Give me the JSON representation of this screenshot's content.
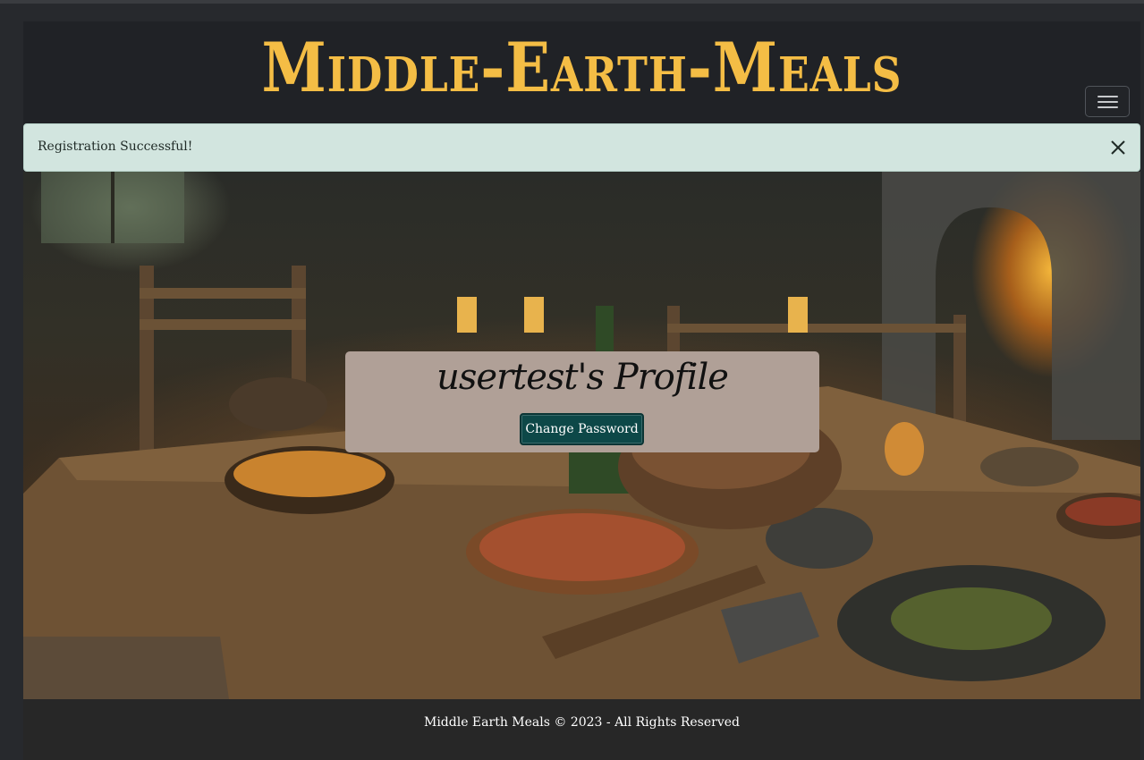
{
  "header": {
    "brand": "Middle-Earth-Meals"
  },
  "alert": {
    "message": "Registration Successful!"
  },
  "profile": {
    "title": "usertest's Profile",
    "change_password_label": "Change Password"
  },
  "footer": {
    "text": "Middle Earth Meals © 2023 - All Rights Reserved"
  },
  "icons": {
    "nav_toggle": "hamburger-icon",
    "alert_close": "close-icon"
  },
  "colors": {
    "brand": "#f4bd45",
    "alert_bg": "#d2e5df",
    "button_bg": "#0d4848",
    "card_bg": "#b0a097"
  }
}
